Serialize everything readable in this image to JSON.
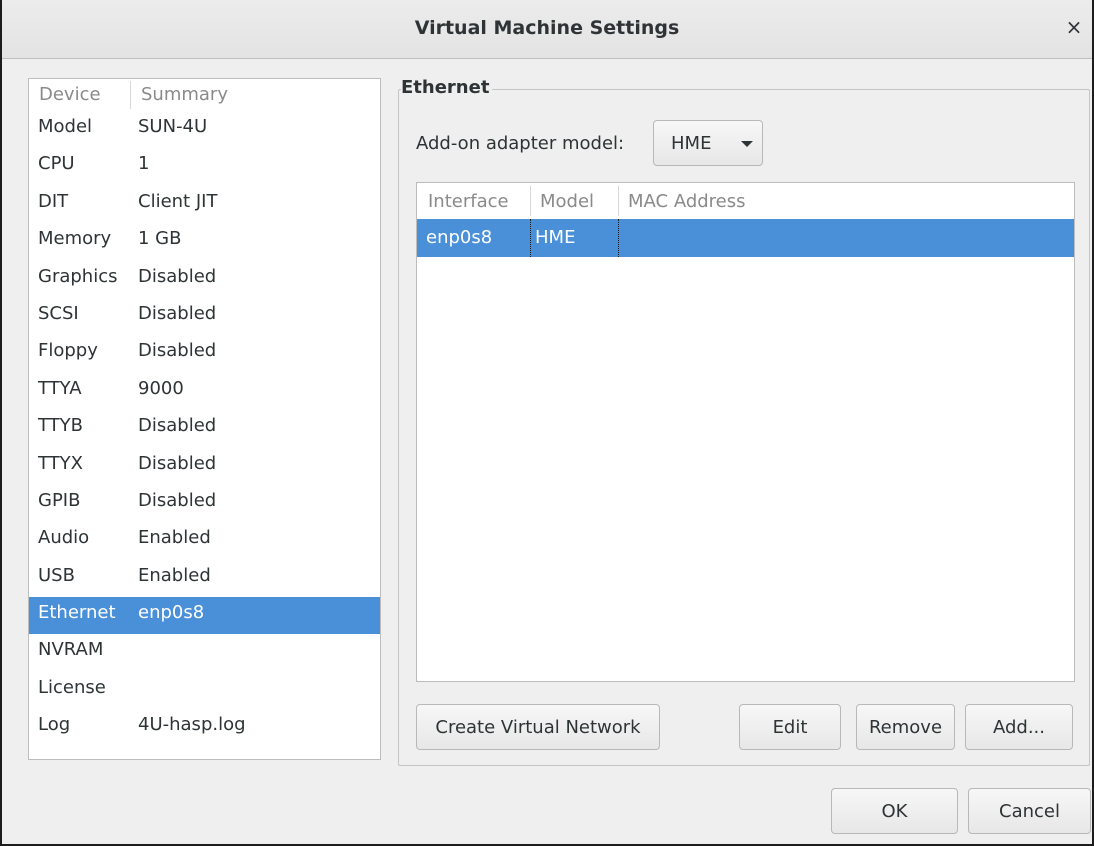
{
  "window": {
    "title": "Virtual Machine Settings",
    "close_glyph": "×"
  },
  "device_list": {
    "headers": {
      "device": "Device",
      "summary": "Summary"
    },
    "rows": [
      {
        "device": "Model",
        "summary": "SUN-4U"
      },
      {
        "device": "CPU",
        "summary": "1"
      },
      {
        "device": "DIT",
        "summary": "Client JIT"
      },
      {
        "device": "Memory",
        "summary": "1 GB"
      },
      {
        "device": "Graphics",
        "summary": "Disabled"
      },
      {
        "device": "SCSI",
        "summary": "Disabled"
      },
      {
        "device": "Floppy",
        "summary": "Disabled"
      },
      {
        "device": "TTYA",
        "summary": "9000"
      },
      {
        "device": "TTYB",
        "summary": "Disabled"
      },
      {
        "device": "TTYX",
        "summary": "Disabled"
      },
      {
        "device": "GPIB",
        "summary": "Disabled"
      },
      {
        "device": "Audio",
        "summary": "Enabled"
      },
      {
        "device": "USB",
        "summary": "Enabled"
      },
      {
        "device": "Ethernet",
        "summary": "enp0s8"
      },
      {
        "device": "NVRAM",
        "summary": ""
      },
      {
        "device": "License",
        "summary": ""
      },
      {
        "device": "Log",
        "summary": "4U-hasp.log"
      }
    ],
    "selected_device": "Ethernet"
  },
  "ethernet": {
    "frame_label": "Ethernet",
    "addon_label": "Add-on adapter model:",
    "adapter_model": "HME",
    "table": {
      "headers": {
        "interface": "Interface",
        "model": "Model",
        "mac": "MAC Address"
      },
      "rows": [
        {
          "interface": "enp0s8",
          "model": "HME",
          "mac": ""
        }
      ]
    },
    "buttons": {
      "create_network": "Create Virtual Network",
      "edit": "Edit",
      "remove": "Remove",
      "add": "Add..."
    }
  },
  "footer": {
    "ok": "OK",
    "cancel": "Cancel"
  },
  "colors": {
    "selection": "#4a90d9",
    "background": "#efefef"
  }
}
